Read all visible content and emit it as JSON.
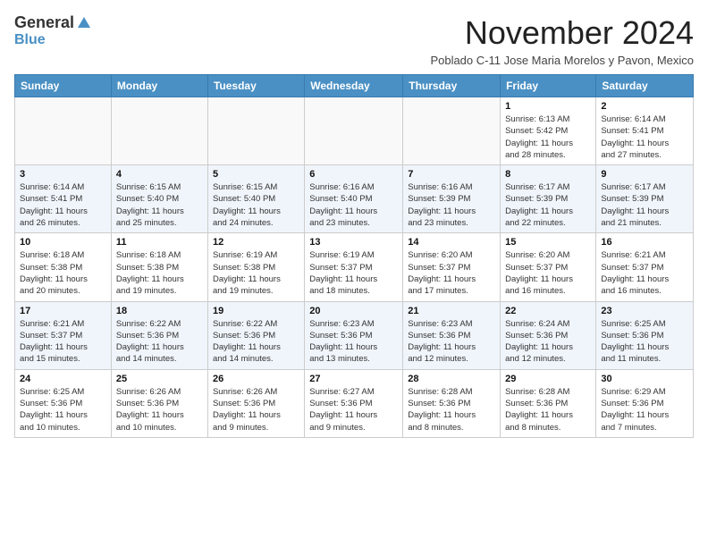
{
  "header": {
    "logo_line1": "General",
    "logo_line2": "Blue",
    "month_title": "November 2024",
    "location": "Poblado C-11 Jose Maria Morelos y Pavon, Mexico"
  },
  "weekdays": [
    "Sunday",
    "Monday",
    "Tuesday",
    "Wednesday",
    "Thursday",
    "Friday",
    "Saturday"
  ],
  "weeks": [
    [
      {
        "day": "",
        "info": ""
      },
      {
        "day": "",
        "info": ""
      },
      {
        "day": "",
        "info": ""
      },
      {
        "day": "",
        "info": ""
      },
      {
        "day": "",
        "info": ""
      },
      {
        "day": "1",
        "info": "Sunrise: 6:13 AM\nSunset: 5:42 PM\nDaylight: 11 hours\nand 28 minutes."
      },
      {
        "day": "2",
        "info": "Sunrise: 6:14 AM\nSunset: 5:41 PM\nDaylight: 11 hours\nand 27 minutes."
      }
    ],
    [
      {
        "day": "3",
        "info": "Sunrise: 6:14 AM\nSunset: 5:41 PM\nDaylight: 11 hours\nand 26 minutes."
      },
      {
        "day": "4",
        "info": "Sunrise: 6:15 AM\nSunset: 5:40 PM\nDaylight: 11 hours\nand 25 minutes."
      },
      {
        "day": "5",
        "info": "Sunrise: 6:15 AM\nSunset: 5:40 PM\nDaylight: 11 hours\nand 24 minutes."
      },
      {
        "day": "6",
        "info": "Sunrise: 6:16 AM\nSunset: 5:40 PM\nDaylight: 11 hours\nand 23 minutes."
      },
      {
        "day": "7",
        "info": "Sunrise: 6:16 AM\nSunset: 5:39 PM\nDaylight: 11 hours\nand 23 minutes."
      },
      {
        "day": "8",
        "info": "Sunrise: 6:17 AM\nSunset: 5:39 PM\nDaylight: 11 hours\nand 22 minutes."
      },
      {
        "day": "9",
        "info": "Sunrise: 6:17 AM\nSunset: 5:39 PM\nDaylight: 11 hours\nand 21 minutes."
      }
    ],
    [
      {
        "day": "10",
        "info": "Sunrise: 6:18 AM\nSunset: 5:38 PM\nDaylight: 11 hours\nand 20 minutes."
      },
      {
        "day": "11",
        "info": "Sunrise: 6:18 AM\nSunset: 5:38 PM\nDaylight: 11 hours\nand 19 minutes."
      },
      {
        "day": "12",
        "info": "Sunrise: 6:19 AM\nSunset: 5:38 PM\nDaylight: 11 hours\nand 19 minutes."
      },
      {
        "day": "13",
        "info": "Sunrise: 6:19 AM\nSunset: 5:37 PM\nDaylight: 11 hours\nand 18 minutes."
      },
      {
        "day": "14",
        "info": "Sunrise: 6:20 AM\nSunset: 5:37 PM\nDaylight: 11 hours\nand 17 minutes."
      },
      {
        "day": "15",
        "info": "Sunrise: 6:20 AM\nSunset: 5:37 PM\nDaylight: 11 hours\nand 16 minutes."
      },
      {
        "day": "16",
        "info": "Sunrise: 6:21 AM\nSunset: 5:37 PM\nDaylight: 11 hours\nand 16 minutes."
      }
    ],
    [
      {
        "day": "17",
        "info": "Sunrise: 6:21 AM\nSunset: 5:37 PM\nDaylight: 11 hours\nand 15 minutes."
      },
      {
        "day": "18",
        "info": "Sunrise: 6:22 AM\nSunset: 5:36 PM\nDaylight: 11 hours\nand 14 minutes."
      },
      {
        "day": "19",
        "info": "Sunrise: 6:22 AM\nSunset: 5:36 PM\nDaylight: 11 hours\nand 14 minutes."
      },
      {
        "day": "20",
        "info": "Sunrise: 6:23 AM\nSunset: 5:36 PM\nDaylight: 11 hours\nand 13 minutes."
      },
      {
        "day": "21",
        "info": "Sunrise: 6:23 AM\nSunset: 5:36 PM\nDaylight: 11 hours\nand 12 minutes."
      },
      {
        "day": "22",
        "info": "Sunrise: 6:24 AM\nSunset: 5:36 PM\nDaylight: 11 hours\nand 12 minutes."
      },
      {
        "day": "23",
        "info": "Sunrise: 6:25 AM\nSunset: 5:36 PM\nDaylight: 11 hours\nand 11 minutes."
      }
    ],
    [
      {
        "day": "24",
        "info": "Sunrise: 6:25 AM\nSunset: 5:36 PM\nDaylight: 11 hours\nand 10 minutes."
      },
      {
        "day": "25",
        "info": "Sunrise: 6:26 AM\nSunset: 5:36 PM\nDaylight: 11 hours\nand 10 minutes."
      },
      {
        "day": "26",
        "info": "Sunrise: 6:26 AM\nSunset: 5:36 PM\nDaylight: 11 hours\nand 9 minutes."
      },
      {
        "day": "27",
        "info": "Sunrise: 6:27 AM\nSunset: 5:36 PM\nDaylight: 11 hours\nand 9 minutes."
      },
      {
        "day": "28",
        "info": "Sunrise: 6:28 AM\nSunset: 5:36 PM\nDaylight: 11 hours\nand 8 minutes."
      },
      {
        "day": "29",
        "info": "Sunrise: 6:28 AM\nSunset: 5:36 PM\nDaylight: 11 hours\nand 8 minutes."
      },
      {
        "day": "30",
        "info": "Sunrise: 6:29 AM\nSunset: 5:36 PM\nDaylight: 11 hours\nand 7 minutes."
      }
    ]
  ]
}
